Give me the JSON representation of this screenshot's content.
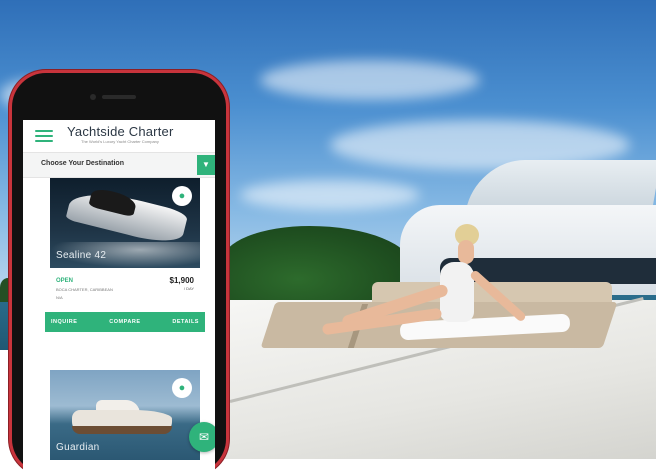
{
  "app": {
    "brand": "Yachtside Charter",
    "tagline": "The World's Luxury Yacht Charter Company",
    "destination_label": "Choose Your Destination",
    "destination_btn_icon": "filter-icon"
  },
  "listings": [
    {
      "name": "Sealine 42",
      "status": "OPEN",
      "location": "BOCA CHARTER, CARIBBEAN",
      "location2": "N/A",
      "price": "$1,900",
      "per": "/ DAY",
      "actions": [
        "INQUIRE",
        "COMPARE",
        "DETAILS"
      ]
    },
    {
      "name": "Guardian"
    }
  ],
  "colors": {
    "accent": "#2fb37b",
    "phone_frame": "#c8343c"
  },
  "icons": {
    "menu": "hamburger-icon",
    "pin": "location-pin-icon",
    "chat": "chat-icon"
  }
}
